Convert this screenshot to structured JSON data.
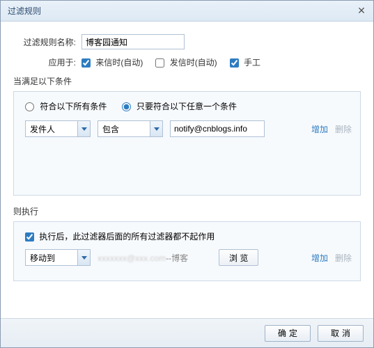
{
  "window": {
    "title": "过滤规则"
  },
  "form": {
    "name_label": "过滤规则名称:",
    "name_value": "博客园通知",
    "apply_label": "应用于:",
    "apply_options": {
      "receive": "来信时(自动)",
      "send": "发信时(自动)",
      "manual": "手工"
    }
  },
  "conditions": {
    "section_title": "当满足以下条件",
    "radio_all": "符合以下所有条件",
    "radio_any": "只要符合以下任意一个条件",
    "row": {
      "field": "发件人",
      "op": "包含",
      "value": "notify@cnblogs.info"
    },
    "add": "增加",
    "remove": "删除"
  },
  "actions": {
    "section_title": "则执行",
    "stop_label": "执行后，此过滤器后面的所有过滤器都不起作用",
    "row": {
      "op": "移动到",
      "target_suffix": "--博客",
      "browse": "浏 览"
    },
    "add": "增加",
    "remove": "删除"
  },
  "footer": {
    "ok": "确定",
    "cancel": "取消"
  }
}
